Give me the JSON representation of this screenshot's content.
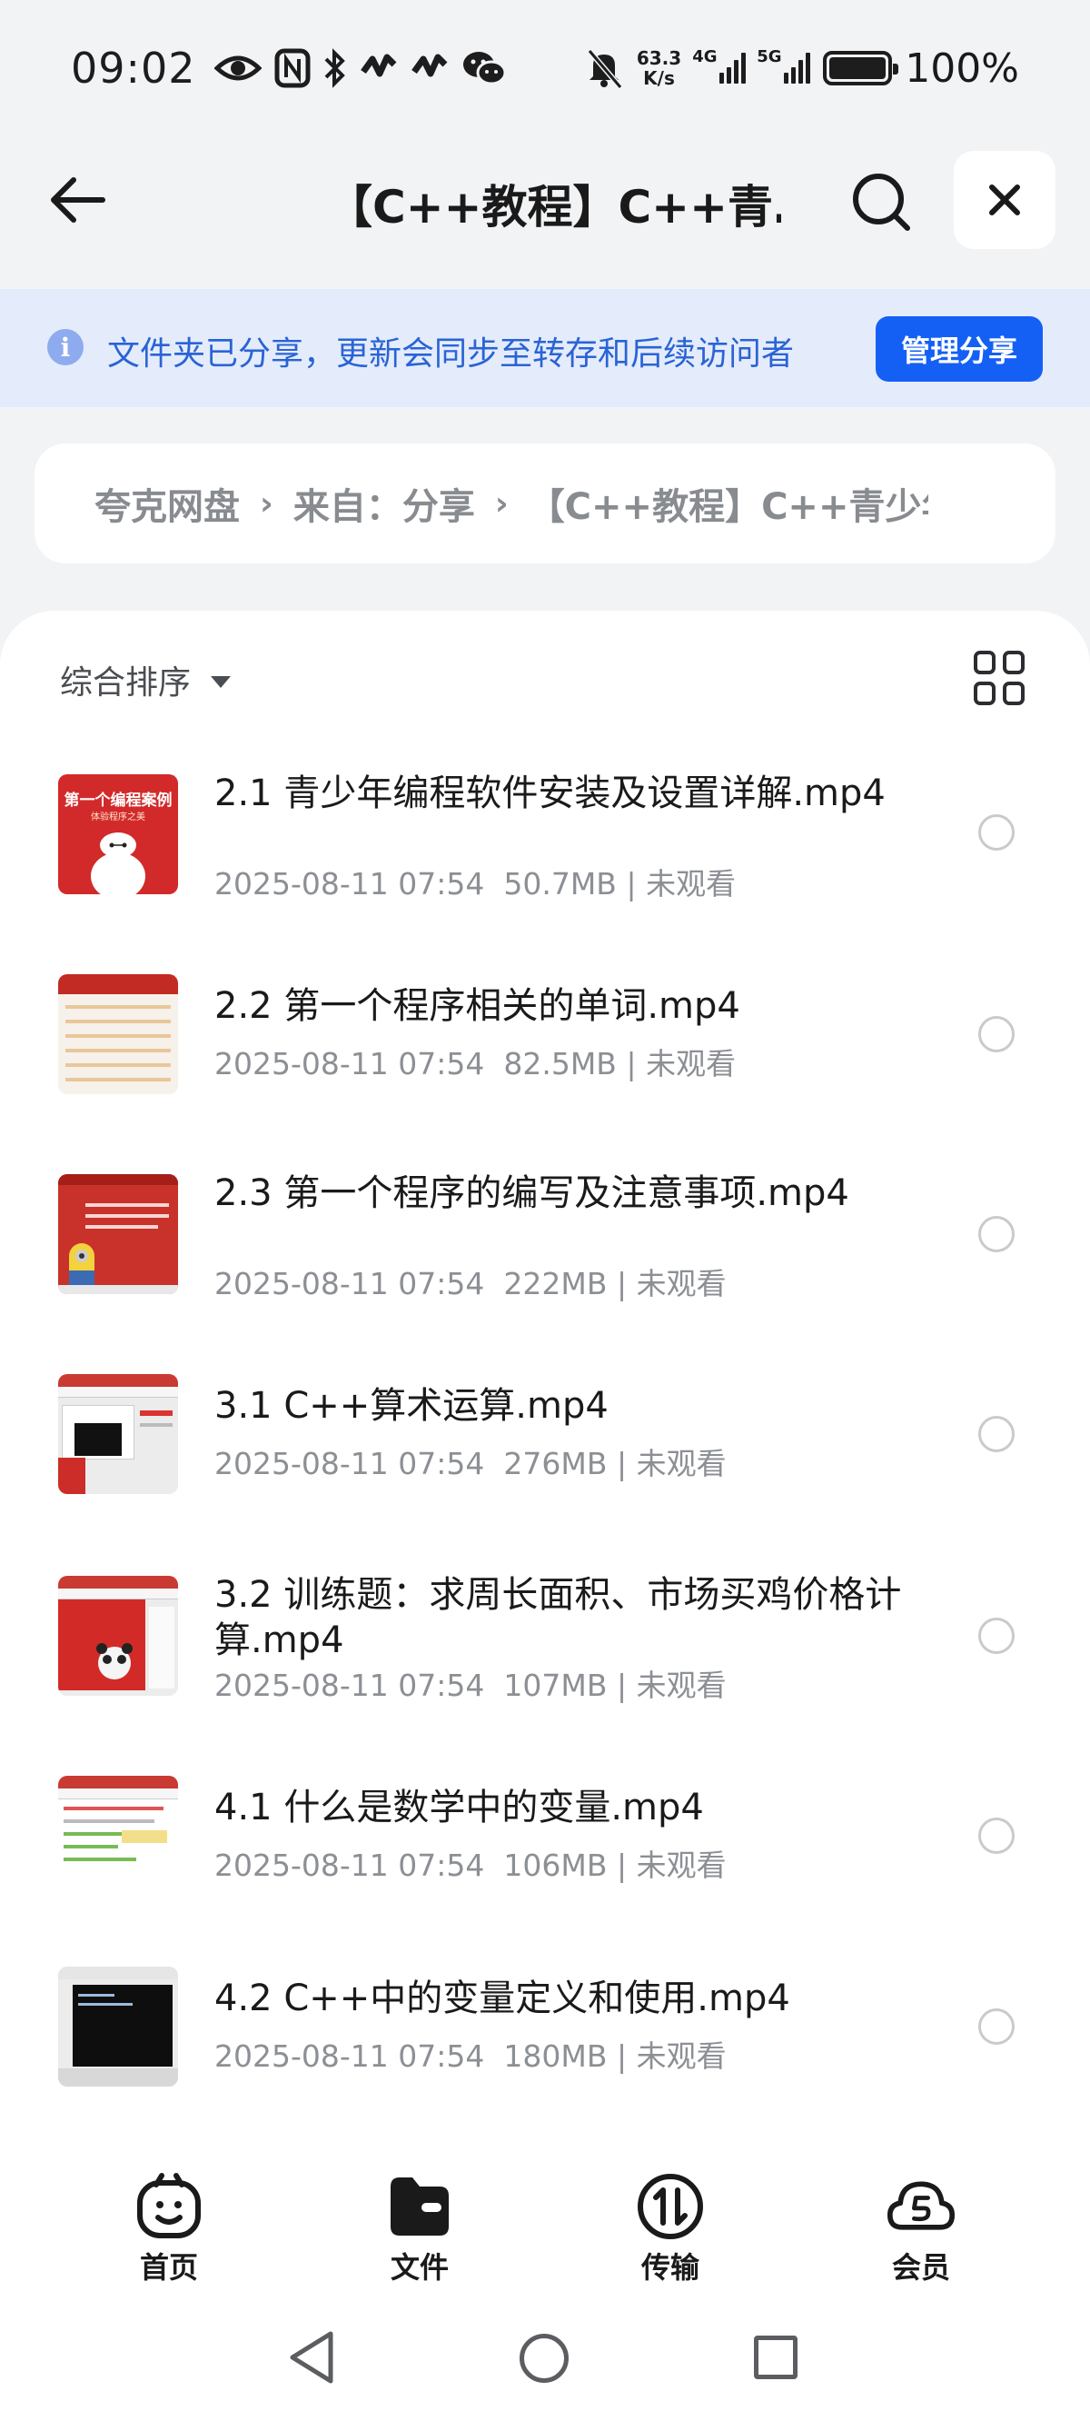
{
  "status_bar": {
    "time": "09:02",
    "net_speed_value": "63.3",
    "net_speed_unit": "K/s",
    "sig1_label": "4G",
    "sig2_label": "5G",
    "battery_pct": "100%",
    "icons": [
      "eye-icon",
      "nfc-icon",
      "bluetooth-icon",
      "heartbeat-icon",
      "heartbeat-icon",
      "wechat-icon",
      "bell-muted-icon"
    ]
  },
  "header": {
    "title": "【C++教程】C++青…"
  },
  "share_banner": {
    "text": "文件夹已分享，更新会同步至转存和后续访问者",
    "button": "管理分享"
  },
  "breadcrumb": {
    "root": "夸克网盘",
    "sep": "›",
    "middle": "来自：分享",
    "current": "【C++教程】C++青少年"
  },
  "sort": {
    "label": "综合排序"
  },
  "files": [
    {
      "name": "2.1 青少年编程软件安装及设置详解.mp4",
      "date": "2025-08-11 07:54",
      "size": "50.7MB",
      "watch": "未观看",
      "thumb": "red-robot",
      "thumb_title": "第一个编程案例",
      "thumb_sub": "体验程序之美"
    },
    {
      "name": "2.2 第一个程序相关的单词.mp4",
      "date": "2025-08-11 07:54",
      "size": "82.5MB",
      "watch": "未观看",
      "thumb": "slide"
    },
    {
      "name": "2.3 第一个程序的编写及注意事项.mp4",
      "date": "2025-08-11 07:54",
      "size": "222MB",
      "watch": "未观看",
      "thumb": "red-minion"
    },
    {
      "name": "3.1 C++算术运算.mp4",
      "date": "2025-08-11 07:54",
      "size": "276MB",
      "watch": "未观看",
      "thumb": "window-console"
    },
    {
      "name": "3.2 训练题：求周长面积、市场买鸡价格计算.mp4",
      "date": "2025-08-11 07:54",
      "size": "107MB",
      "watch": "未观看",
      "thumb": "red-panda"
    },
    {
      "name": "4.1 什么是数学中的变量.mp4",
      "date": "2025-08-11 07:54",
      "size": "106MB",
      "watch": "未观看",
      "thumb": "window-doc"
    },
    {
      "name": "4.2 C++中的变量定义和使用.mp4",
      "date": "2025-08-11 07:54",
      "size": "180MB",
      "watch": "未观看",
      "thumb": "console"
    }
  ],
  "meta_sep": "|",
  "bottom_nav": [
    {
      "label": "首页",
      "icon": "smile-icon"
    },
    {
      "label": "文件",
      "icon": "folder-icon"
    },
    {
      "label": "传输",
      "icon": "transfer-icon"
    },
    {
      "label": "会员",
      "icon": "cloud-vip-icon"
    }
  ],
  "colors": {
    "accent": "#1560f4",
    "banner_bg": "#e4ecfb",
    "banner_text": "#2a63d6",
    "page_bg": "#f2f3f5"
  }
}
